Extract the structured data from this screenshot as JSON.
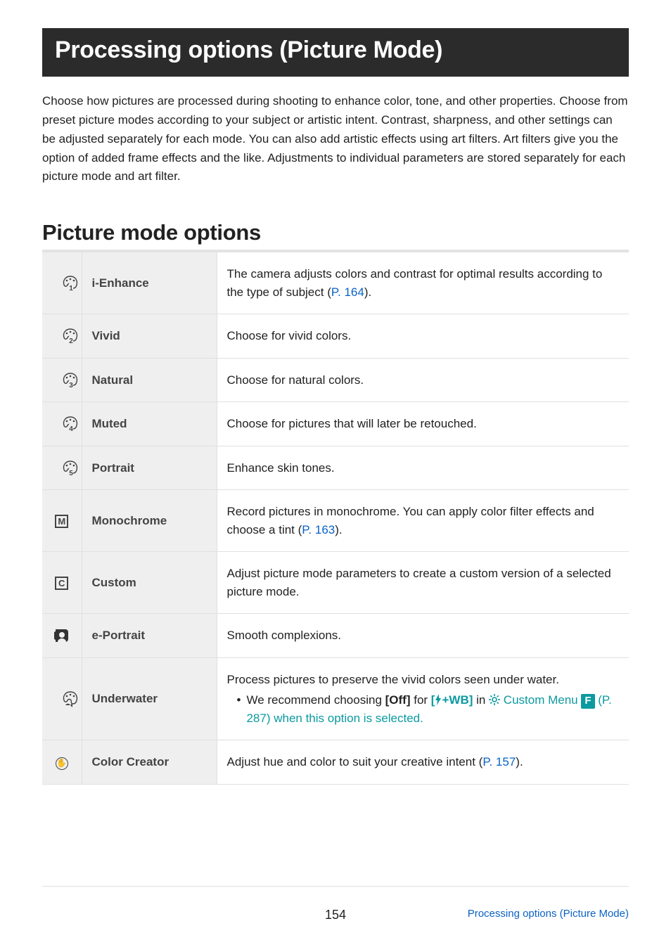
{
  "title": "Processing options (Picture Mode)",
  "intro": "Choose how pictures are processed during shooting to enhance color, tone, and other properties. Choose from preset picture modes according to your subject or artistic intent. Contrast, sharpness, and other settings can be adjusted separately for each mode. You can also add artistic effects using art filters. Art filters give you the option of added frame effects and the like. Adjustments to individual parameters are stored separately for each picture mode and art filter.",
  "section_heading": "Picture mode options",
  "rows": {
    "ienhance": {
      "name": "i-Enhance",
      "desc_pre": "The camera adjusts colors and contrast for optimal results according to the type of subject (",
      "link": "P. 164",
      "desc_post": ")."
    },
    "vivid": {
      "name": "Vivid",
      "desc": "Choose for vivid colors."
    },
    "natural": {
      "name": "Natural",
      "desc": "Choose for natural colors."
    },
    "muted": {
      "name": "Muted",
      "desc": "Choose for pictures that will later be retouched."
    },
    "portrait": {
      "name": "Portrait",
      "desc": "Enhance skin tones."
    },
    "monochrome": {
      "name": "Monochrome",
      "desc_pre": "Record pictures in monochrome. You can apply color filter effects and choose a tint (",
      "link": "P. 163",
      "desc_post": ")."
    },
    "custom": {
      "name": "Custom",
      "desc": "Adjust picture mode parameters to create a custom version of a selected picture mode."
    },
    "eportrait": {
      "name": "e-Portrait",
      "desc": "Smooth complexions."
    },
    "underwater": {
      "name": "Underwater",
      "line1": "Process pictures to preserve the vivid colors seen under water.",
      "bullet_pre": "We recommend choosing ",
      "bullet_off": "[Off]",
      "bullet_mid": " for ",
      "flash_wb": "+WB]",
      "bullet_in": " in ",
      "custom_menu": " Custom Menu ",
      "f_label": "F",
      "p287_pre": " (",
      "p287": "P. 287",
      "p287_post": ") when this option is selected."
    },
    "colorcreator": {
      "name": "Color Creator",
      "desc_pre": "Adjust hue and color to suit your creative intent (",
      "link": "P. 157",
      "desc_post": ")."
    }
  },
  "page_number": "154",
  "breadcrumb": "Processing options (Picture Mode)"
}
